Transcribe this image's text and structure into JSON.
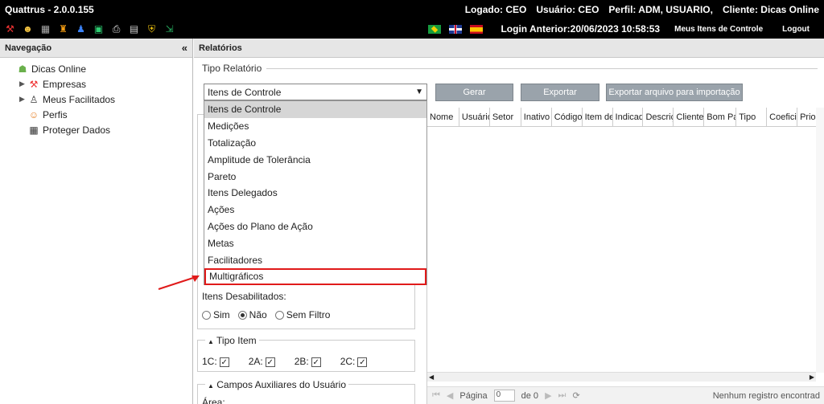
{
  "titlebar": {
    "app_title": "Quattrus - 2.0.0.155",
    "logado": "Logado: CEO",
    "usuario": "Usuário: CEO",
    "perfil": "Perfil: ADM, USUARIO,",
    "cliente": "Cliente: Dicas Online"
  },
  "toolbar": {
    "login_anterior": "Login Anterior:20/06/2023 10:58:53",
    "meus_itens": "Meus Itens de Controle",
    "logout": "Logout"
  },
  "nav": {
    "header": "Navegação",
    "tree": [
      {
        "label": "Dicas Online",
        "expand": ""
      },
      {
        "label": "Empresas",
        "expand": "▶"
      },
      {
        "label": "Meus Facilitados",
        "expand": "▶"
      },
      {
        "label": "Perfis",
        "expand": ""
      },
      {
        "label": "Proteger Dados",
        "expand": ""
      }
    ]
  },
  "main": {
    "header": "Relatórios",
    "fieldset_legend": "Tipo Relatório",
    "select_value": "Itens de Controle",
    "buttons": {
      "gerar": "Gerar",
      "exportar": "Exportar",
      "exportar_arquivo": "Exportar arquivo para importação"
    },
    "dropdown": [
      "Itens de Controle",
      "Medições",
      "Totalização",
      "Amplitude de Tolerância",
      "Pareto",
      "Itens Delegados",
      "Ações",
      "Ações do Plano de Ação",
      "Metas",
      "Facilitadores",
      "Multigráficos"
    ],
    "itens_desabilitados": {
      "label": "Itens Desabilitados:",
      "options": [
        "Sim",
        "Não",
        "Sem Filtro"
      ]
    },
    "tipo_item": {
      "title": "Tipo Item",
      "checks": [
        "1C:",
        "2A:",
        "2B:",
        "2C:"
      ]
    },
    "campos_aux": {
      "title": "Campos Auxiliares do Usuário",
      "area_label": "Área:"
    },
    "grid": {
      "columns": [
        "Nome",
        "Usuário",
        "Setor",
        "Inativo",
        "Código",
        "Item de",
        "Indicad",
        "Descriç",
        "Cliente",
        "Bom Pa",
        "Tipo",
        "Coefici",
        "Priori"
      ],
      "pager_label": "Página",
      "pager_value": "0",
      "pager_of": "de 0",
      "no_records": "Nenhum registro encontrad"
    }
  }
}
